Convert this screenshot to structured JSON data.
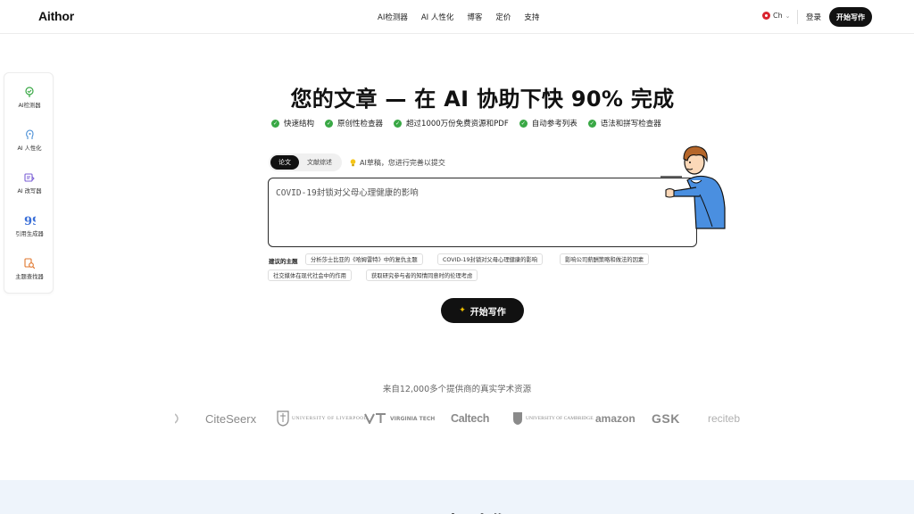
{
  "header": {
    "logo": "Aithor",
    "nav": [
      "AI检测器",
      "AI 人性化",
      "博客",
      "定价",
      "支持"
    ],
    "lang": "Ch",
    "login": "登录",
    "cta": "开始写作"
  },
  "sidebar": {
    "items": [
      {
        "label": "AI检测器",
        "icon": "ai-detector-icon"
      },
      {
        "label": "AI 人性化",
        "icon": "humanizer-icon"
      },
      {
        "label": "AI 改写器",
        "icon": "rewriter-icon"
      },
      {
        "label": "引用生成器",
        "icon": "quote-icon"
      },
      {
        "label": "主题查找器",
        "icon": "topic-finder-icon"
      }
    ]
  },
  "hero": {
    "title": "您的文章 — 在 AI 协助下快 90% 完成",
    "features": [
      "快速结构",
      "原创性检查器",
      "超过1000万份免费资源和PDF",
      "自动参考列表",
      "语法和拼写检查器"
    ]
  },
  "editor": {
    "tabs": [
      "论文",
      "文献综述"
    ],
    "hint": "AI草稿，您进行完善以提交",
    "placeholder": "COVID-19封锁对父母心理健康的影响"
  },
  "suggestions": {
    "label": "建议的主题",
    "topics": [
      "分析莎士比亚的《哈姆雷特》中的复仇主题",
      "COVID-19封锁对父母心理健康的影响",
      "影响公司薪酬策略和做法的因素",
      "社交媒体在现代社会中的作用",
      "获取研究参与者的知情同意时的伦理考虑"
    ]
  },
  "start_button": "开始写作",
  "sources": {
    "title": "来自12,000多个提供商的真实学术资源",
    "logos": [
      "CiteSeerx",
      "UNIVERSITY OF LIVERPOOL",
      "VIRGINIA TECH",
      "Caltech",
      "UNIVERSITY OF CAMBRIDGE",
      "amazon",
      "GSK",
      "reciteb"
    ]
  },
  "bottom": {
    "title": "可以帮助您"
  },
  "colors": {
    "accent": "#111111",
    "check": "#39a845",
    "band": "#eef4fb"
  }
}
